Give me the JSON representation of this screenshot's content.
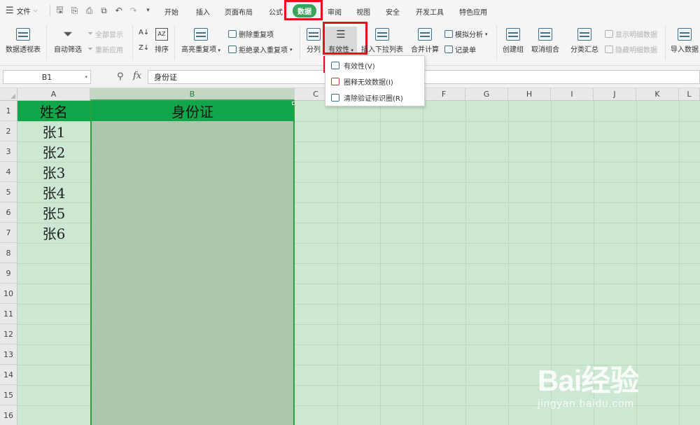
{
  "menubar": {
    "file_label": "文件",
    "tabs": [
      "开始",
      "插入",
      "页面布局",
      "公式",
      "数据",
      "审阅",
      "视图",
      "安全",
      "开发工具",
      "特色应用"
    ],
    "active_tab": "数据"
  },
  "ribbon": {
    "pivot": "数据透视表",
    "auto_filter": "自动筛选",
    "show_all": "全部显示",
    "reapply": "重新应用",
    "sort": "排序",
    "highlight_dup": "高亮重复项",
    "remove_dup": "删除重复项",
    "reject_dup": "拒绝录入重复项",
    "split": "分列",
    "validity": "有效性",
    "insert_dropdown": "插入下拉列表",
    "merge_calc": "合并计算",
    "what_if": "模拟分析",
    "record_form": "记录单",
    "create_group": "创建组",
    "ungroup": "取消组合",
    "subtotal": "分类汇总",
    "show_detail": "显示明细数据",
    "hide_detail": "隐藏明细数据",
    "import_data": "导入数据"
  },
  "dropdown": {
    "items": [
      "有效性(V)",
      "圈释无效数据(I)",
      "清除验证标识圈(R)"
    ]
  },
  "formula_bar": {
    "name_box": "B1",
    "fx": "fx",
    "content": "身份证"
  },
  "sheet": {
    "columns": [
      "A",
      "B",
      "C",
      "D",
      "E",
      "F",
      "G",
      "H",
      "I",
      "J",
      "K",
      "L"
    ],
    "rows": [
      "1",
      "2",
      "3",
      "4",
      "5",
      "6",
      "7",
      "8",
      "9",
      "10",
      "11",
      "12",
      "13",
      "14",
      "15",
      "16"
    ],
    "header_a": "姓名",
    "header_b": "身份证",
    "names": [
      "张1",
      "张2",
      "张3",
      "张4",
      "张5",
      "张6"
    ]
  },
  "watermark": {
    "brand": "Bai经验",
    "url": "jingyan.baidu.com"
  },
  "colors": {
    "accent": "#3aa55a",
    "highlight_red": "#e8101a",
    "sheet_bg": "#cde8d2",
    "header_green": "#12a64a"
  }
}
